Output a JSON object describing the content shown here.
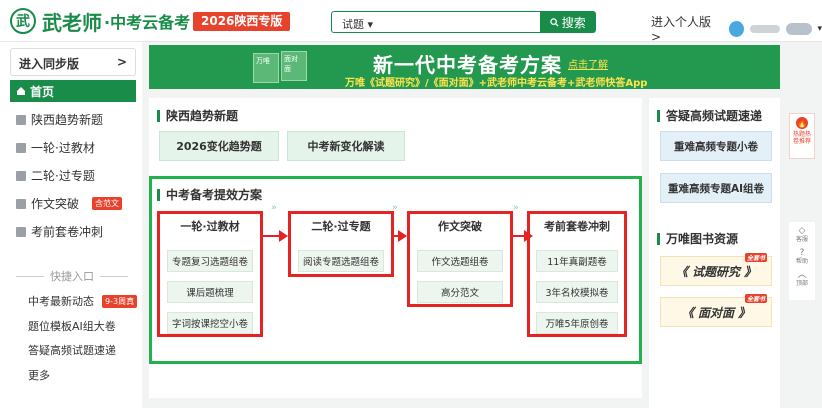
{
  "header": {
    "logo_mark": "武",
    "logo_title": "武老师",
    "logo_sub": "·中考云备考",
    "region_badge": "2026陕西专版",
    "search_scope": "试题 ▾",
    "search_button": "搜索",
    "personal_link": "进入个人版 >",
    "caret": "▾"
  },
  "sidebar": {
    "sync_label": "进入同步版",
    "sync_chevron": ">",
    "home_label": "首页",
    "items": [
      {
        "label": "陕西趋势新题"
      },
      {
        "label": "一轮·过教材"
      },
      {
        "label": "二轮·过专题"
      },
      {
        "label": "作文突破",
        "tag": "含范文"
      },
      {
        "label": "考前套卷冲刺"
      }
    ],
    "quick_title": "快捷入口",
    "quick_items": [
      {
        "label": "中考最新动态",
        "tag": "9-3周真"
      },
      {
        "label": "题位模板AI组大卷"
      },
      {
        "label": "答疑高频试题速递"
      },
      {
        "label": "更多"
      }
    ]
  },
  "banner": {
    "title": "新一代中考备考方案",
    "link": "点击了解",
    "subtitle": "万唯《试题研究》/《面对面》+武老师中考云备考+武老师快答App",
    "book1": "万唯",
    "book2": "面对面"
  },
  "trend": {
    "title": "陕西趋势新题",
    "buttons": [
      "2026变化趋势题",
      "中考新变化解读"
    ]
  },
  "plan": {
    "title": "中考备考提效方案",
    "chevron": "»",
    "columns": [
      {
        "title": "一轮·过教材",
        "items": [
          "专题复习选题组卷",
          "课后题梳理",
          "字词按课挖空小卷"
        ]
      },
      {
        "title": "二轮·过专题",
        "items": [
          "阅读专题选题组卷"
        ]
      },
      {
        "title": "作文突破",
        "items": [
          "作文选题组卷",
          "高分范文"
        ]
      },
      {
        "title": "考前套卷冲刺",
        "items": [
          "11年真副题卷",
          "3年名校模拟卷",
          "万唯5年原创卷"
        ]
      }
    ]
  },
  "right_panel": {
    "faq_title": "答疑高频试题速递",
    "faq_buttons": [
      "重难高频专题小卷",
      "重难高频专题AI组卷"
    ],
    "books_title": "万唯图书资源",
    "books": [
      {
        "label": "《 试题研究 》",
        "tag": "全套书"
      },
      {
        "label": "《 面对面 》",
        "tag": "全套书"
      }
    ]
  },
  "rail": {
    "hot_icon": "🔥",
    "hot_label": "热题热卷推荐",
    "tools": [
      {
        "icon": "◇",
        "label": "客服"
      },
      {
        "icon": "?",
        "label": "帮助"
      },
      {
        "icon": "︿",
        "label": "顶部"
      }
    ]
  },
  "colors": {
    "brand_green": "#1a8c4a",
    "banner_green": "#23994f",
    "highlight_red": "#e52323",
    "highlight_green": "#22b14c",
    "badge_red": "#e8412c",
    "banner_yellow": "#ffe34d"
  }
}
